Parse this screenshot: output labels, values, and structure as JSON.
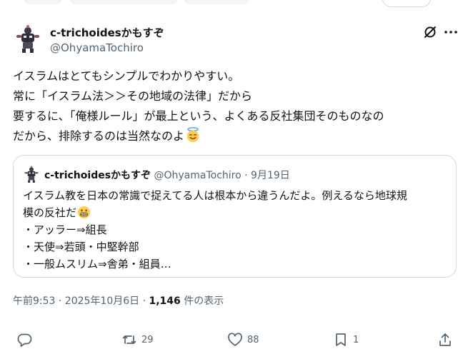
{
  "tweet": {
    "author_name": "c-trichoidesかもすぞ",
    "author_handle": "@OhyamaTochiro",
    "lines": [
      "イスラムはとてもシンプルでわかりやすい。",
      "常に「イスラム法＞＞その地域の法律」だから",
      "要するに、「俺様ルール」が最上という、よくある反社集団そのものなの",
      "だから、排除するのは当然なのよ"
    ],
    "emoji_end": "smiling-face-with-halo"
  },
  "quote": {
    "author_name": "c-trichoidesかもすぞ",
    "author_handle": "@OhyamaTochiro",
    "separator": "·",
    "date": "9月19日",
    "lines": [
      "イスラム教を日本の常識で捉えてる人は根本から違うんだよ。例えるなら地球規",
      "模の反社だ",
      "・アッラー⇒組長",
      "・天使⇒若頭・中堅幹部",
      "・一般ムスリム⇒舎弟・組員…"
    ],
    "emoji": "grimacing-face"
  },
  "meta": {
    "timestamp": "午前9:53 · 2025年10月6日 · ",
    "views_count": "1,146",
    "views_label": " 件の表示"
  },
  "actions": {
    "reply_count": "",
    "repost_count": "29",
    "like_count": "88",
    "bookmark_count": "1"
  },
  "colors": {
    "text": "#0f1419",
    "secondary": "#536471",
    "border": "#cfd9de"
  }
}
